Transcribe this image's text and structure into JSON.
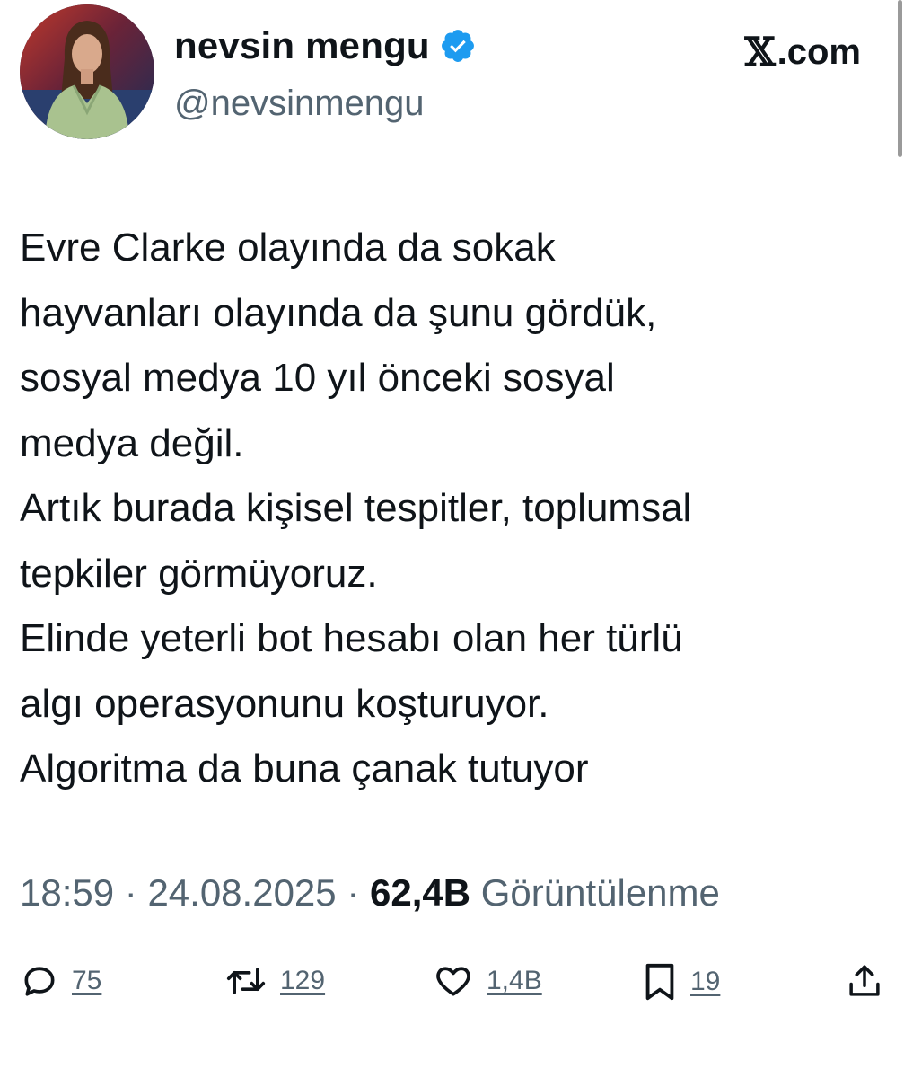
{
  "user": {
    "display_name": "nevsin mengu",
    "handle": "@nevsinmengu",
    "verified": true
  },
  "brand": {
    "mark": "𝕏",
    "label": ".com"
  },
  "tweet": {
    "lines": [
      "Evre Clarke olayında da sokak",
      "hayvanları olayında da şunu gördük,",
      "sosyal medya 10 yıl önceki sosyal",
      "medya değil.",
      "Artık burada kişisel tespitler, toplumsal",
      "tepkiler görmüyoruz.",
      "Elinde yeterli bot hesabı olan her türlü",
      "algı operasyonunu koşturuyor.",
      "Algoritma da buna çanak tutuyor"
    ]
  },
  "meta": {
    "time": "18:59",
    "sep1": " · ",
    "date": "24.08.2025",
    "sep2": " · ",
    "views_count": "62,4B",
    "views_label": " Görüntülenme"
  },
  "actions": {
    "replies": "75",
    "reposts": "129",
    "likes": "1,4B",
    "bookmarks": "19"
  },
  "colors": {
    "text": "#0f1419",
    "secondary": "#536471",
    "verified": "#1d9bf0"
  }
}
